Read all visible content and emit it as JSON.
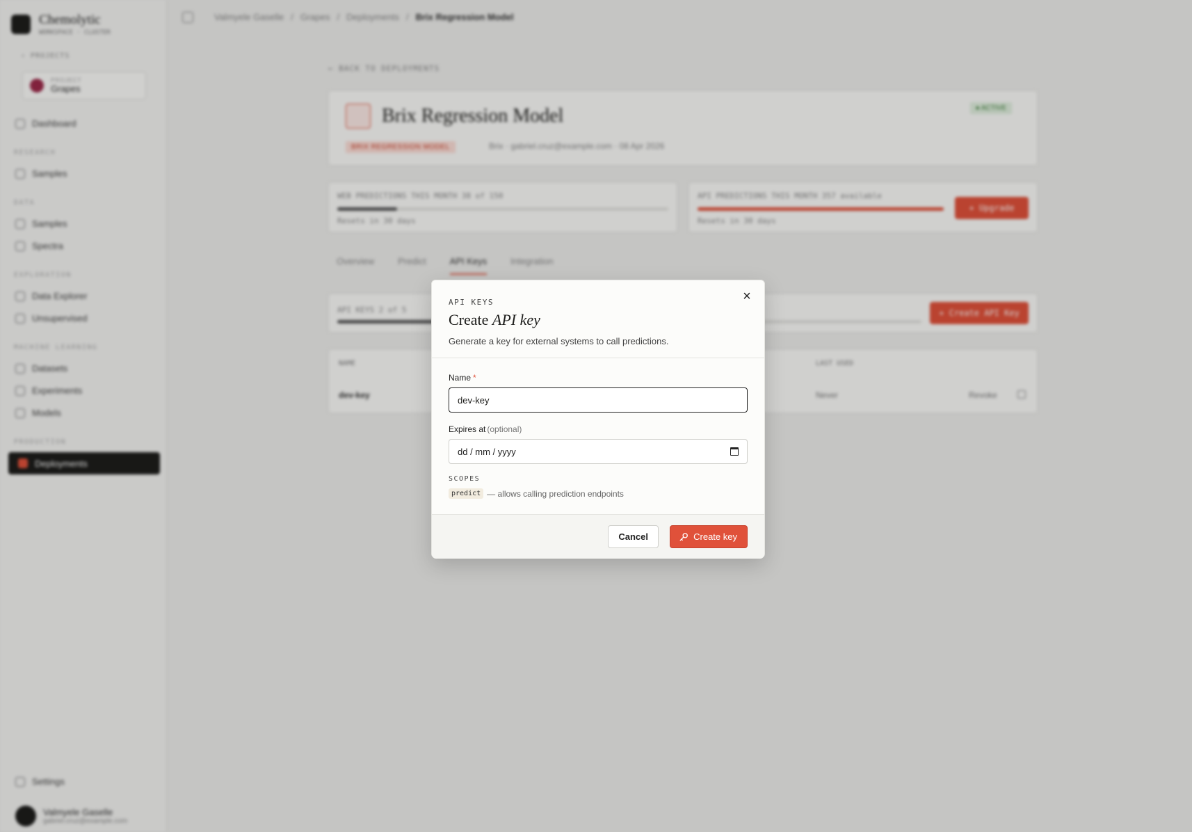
{
  "app": {
    "brand_name": "Chemolytic",
    "brand_sub": "WORKSPACE · CLUSTER",
    "back_projects": "PROJECTS",
    "project_small_label": "PROJECT",
    "project_name": "Grapes"
  },
  "sidebar": {
    "dashboard": "Dashboard",
    "sections": [
      "RESEARCH",
      "DATA",
      "EXPLORATION",
      "MACHINE LEARNING",
      "PRODUCTION"
    ],
    "items": {
      "samples_nav": "Samples",
      "samples": "Samples",
      "spectra": "Spectra",
      "data_explorer": "Data Explorer",
      "unsupervised": "Unsupervised",
      "datasets": "Datasets",
      "experiments": "Experiments",
      "models": "Models",
      "deployments": "Deployments"
    },
    "settings": "Settings",
    "user_name": "Valmyele Gaselle",
    "user_email": "gabriel.cruz@example.com"
  },
  "topbar": {
    "crumbs": [
      "Valmyele Gaselle",
      "Grapes",
      "Deployments",
      "Brix Regression Model"
    ]
  },
  "deployment": {
    "back_link": "← BACK TO DEPLOYMENTS",
    "title": "Brix Regression Model",
    "badge": "BRIX REGRESSION MODEL",
    "meta": "Brix · gabriel.cruz@example.com · 08 Apr 2026",
    "status": "● ACTIVE",
    "usage_left": "WEB PREDICTIONS THIS MONTH  38 of 150",
    "usage_left_sub": "Resets in 30 days",
    "usage_left_fraction": 0.18,
    "usage_right": "API PREDICTIONS THIS MONTH  357 available",
    "usage_right_sub": "Resets in 30 days",
    "usage_right_fraction": 1.0,
    "upgrade": "+ Upgrade",
    "tabs": [
      "Overview",
      "Predict",
      "API Keys",
      "Integration"
    ],
    "active_tab": "API Keys",
    "keys_count": "API KEYS  2 of 5",
    "keys_fraction": 0.4,
    "create_api_key_bg": "+ Create API Key",
    "col_name": "NAME",
    "col_last_used": "LAST USED",
    "row_name": "dev-key",
    "row_last_used": "Never",
    "row_revoke": "Revoke"
  },
  "modal": {
    "eyebrow": "API KEYS",
    "title_plain": "Create ",
    "title_italic": "API key",
    "description": "Generate a key for external systems to call predictions.",
    "name_label": "Name",
    "required_mark": "*",
    "name_value": "dev-key",
    "expires_label": "Expires at",
    "expires_optional": "(optional)",
    "expires_placeholder": "dd / mm / yyyy",
    "scopes_label": "SCOPES",
    "scope_chip": "predict",
    "scope_desc": "— allows calling prediction endpoints",
    "cancel_label": "Cancel",
    "create_label": "Create key",
    "close_glyph": "×"
  },
  "colors": {
    "accent": "#e0513a",
    "dark": "#1d1d1b",
    "overlay": "rgba(0,0,0,0.17)"
  }
}
